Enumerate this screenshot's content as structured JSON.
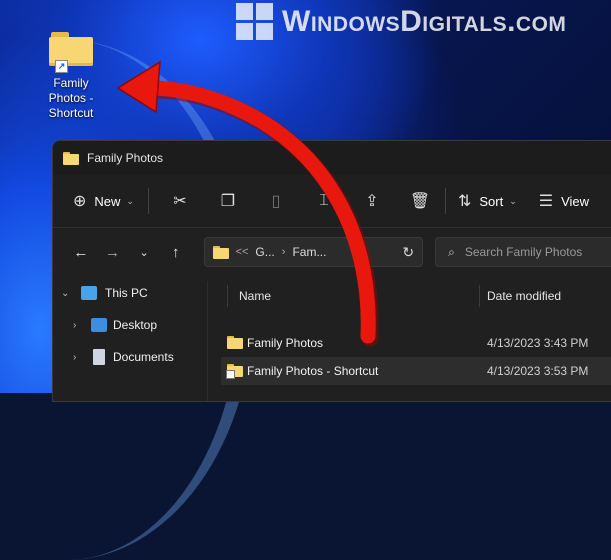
{
  "watermark": {
    "text": "WindowsDigitals.com",
    "icon": "windows-logo"
  },
  "desktop": {
    "shortcut_label": "Family Photos - Shortcut",
    "shortcut_label_lines": [
      "Family",
      "Photos -",
      "Shortcut"
    ],
    "icon": "folder-shortcut-icon"
  },
  "window": {
    "title": "Family Photos",
    "toolbar": {
      "new_label": "New",
      "sort_label": "Sort",
      "view_label": "View",
      "icons": [
        "add-icon",
        "cut-icon",
        "copy-icon",
        "paste-icon",
        "rename-icon",
        "share-icon",
        "delete-icon",
        "sort-icon",
        "view-icon"
      ]
    },
    "address": {
      "overflow": "<<",
      "segments": [
        "G...",
        "Fam..."
      ],
      "search_placeholder": "Search Family Photos"
    },
    "nav_pane": [
      {
        "label": "This PC",
        "icon": "this-pc-icon",
        "expanded": true
      },
      {
        "label": "Desktop",
        "icon": "desktop-icon",
        "expanded": false
      },
      {
        "label": "Documents",
        "icon": "documents-icon",
        "expanded": false
      }
    ],
    "columns": [
      "Name",
      "Date modified"
    ],
    "files": [
      {
        "name": "Family Photos",
        "date": "4/13/2023 3:43 PM",
        "type": "folder",
        "selected": false
      },
      {
        "name": "Family Photos - Shortcut",
        "date": "4/13/2023 3:53 PM",
        "type": "folder-shortcut",
        "selected": true
      }
    ]
  },
  "colors": {
    "arrow": "#e8180e",
    "window_bg": "#202020",
    "folder": "#f7d774"
  }
}
